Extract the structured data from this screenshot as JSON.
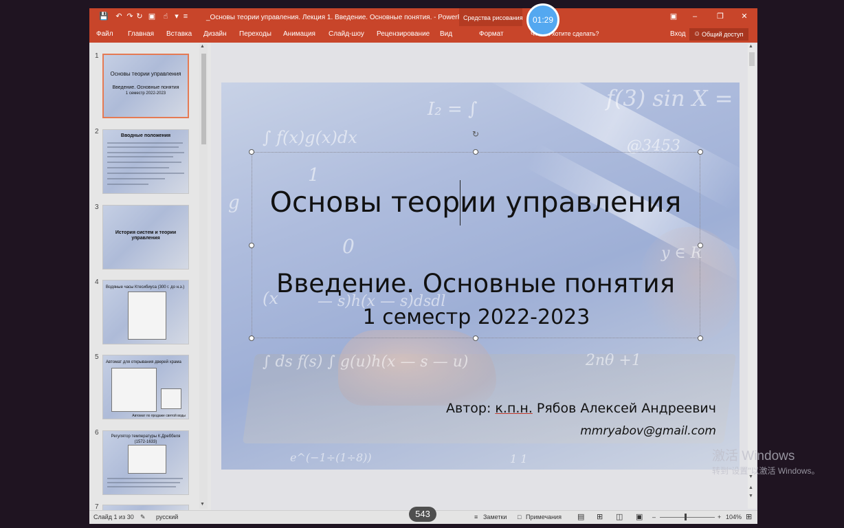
{
  "window": {
    "doc_title": "_Основы теории управления. Лекция 1. Введение. Основные понятия. - PowerPoint",
    "context_group": "Средства рисования",
    "timer": "01:29"
  },
  "ribbon": {
    "tabs": [
      "Файл",
      "Главная",
      "Вставка",
      "Дизайн",
      "Переходы",
      "Анимация",
      "Слайд-шоу",
      "Рецензирование",
      "Вид"
    ],
    "format_tab": "Формат",
    "tell_me": "Что вы хотите сделать?",
    "sign_in": "Вход",
    "share": "Общий доступ"
  },
  "thumbnails": [
    {
      "num": "1",
      "title": "Основы теории управления",
      "sub": "Введение. Основные понятия",
      "sub2": "1 семестр 2022-2023"
    },
    {
      "num": "2",
      "title": "Вводные положения"
    },
    {
      "num": "3",
      "title": "История систем и теории управления"
    },
    {
      "num": "4",
      "title": "Водяные часы Ктесибиуса (300 г. до н.э.)"
    },
    {
      "num": "5",
      "title": "Автомат для открывания дверей храма",
      "caption": "Автомат по продаже святой воды"
    },
    {
      "num": "6",
      "title": "Регулятор температуры К.Дреббеля (1572-1633)"
    },
    {
      "num": "7",
      "title": ""
    }
  ],
  "slide": {
    "title": "Основы теории управления",
    "subtitle1": "Введение. Основные понятия",
    "subtitle2": "1 семестр 2022-2023",
    "author_prefix": "Автор:",
    "author_degree": "к.п.н.",
    "author_name": "Рябов Алексей Андреевич",
    "email": "mmryabov@gmail.com"
  },
  "status": {
    "slide_info": "Слайд 1 из 30",
    "language": "русский",
    "notes": "Заметки",
    "comments": "Примечания",
    "zoom": "104%",
    "counter": "543"
  },
  "watermark": {
    "line1": "激活 Windows",
    "line2": "转到\"设置\"以激活 Windows。"
  }
}
